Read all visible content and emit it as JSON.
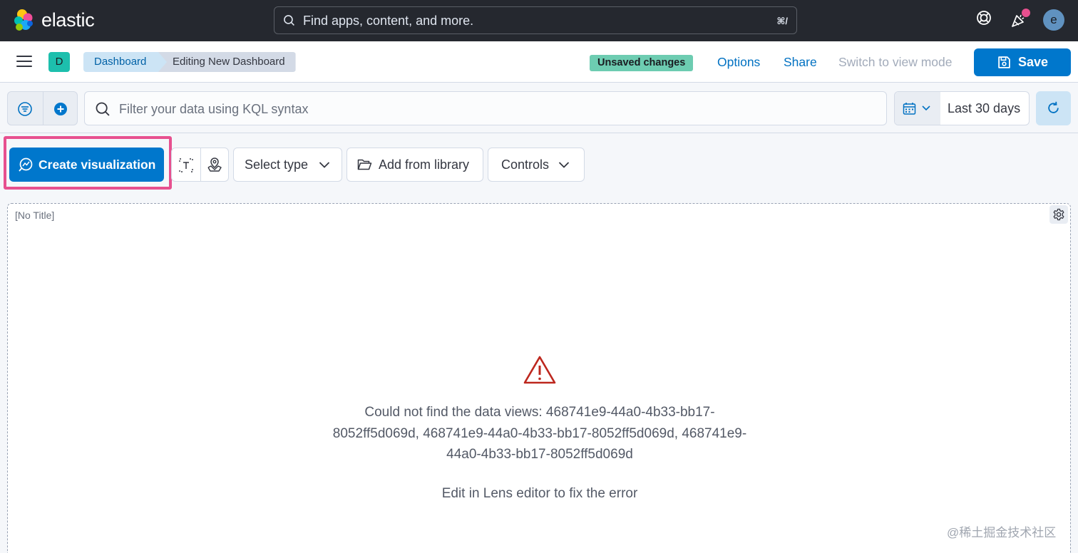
{
  "header": {
    "brand": "elastic",
    "search_placeholder": "Find apps, content, and more.",
    "search_shortcut": "⌘/",
    "user_initial": "e"
  },
  "appbar": {
    "space_initial": "D",
    "breadcrumbs": [
      "Dashboard",
      "Editing New Dashboard"
    ],
    "unsaved_badge": "Unsaved changes",
    "options_label": "Options",
    "share_label": "Share",
    "view_mode_label": "Switch to view mode",
    "save_label": "Save"
  },
  "querybar": {
    "kql_placeholder": "Filter your data using KQL syntax",
    "date_range": "Last 30 days"
  },
  "toolbar": {
    "create_visualization": "Create visualization",
    "select_type": "Select type",
    "add_from_library": "Add from library",
    "controls": "Controls"
  },
  "panel": {
    "title": "[No Title]",
    "error_message": "Could not find the data views: 468741e9-44a0-4b33-bb17-8052ff5d069d, 468741e9-44a0-4b33-bb17-8052ff5d069d, 468741e9-44a0-4b33-bb17-8052ff5d069d",
    "error_hint": "Edit in Lens editor to fix the error"
  },
  "watermark": "@稀土掘金技术社区",
  "colors": {
    "header_bg": "#25282f",
    "primary": "#0077cc",
    "highlight": "#e7508f",
    "unsaved_badge": "#6dccb1",
    "space_badge": "#1dbfad",
    "warning": "#bd271e"
  }
}
